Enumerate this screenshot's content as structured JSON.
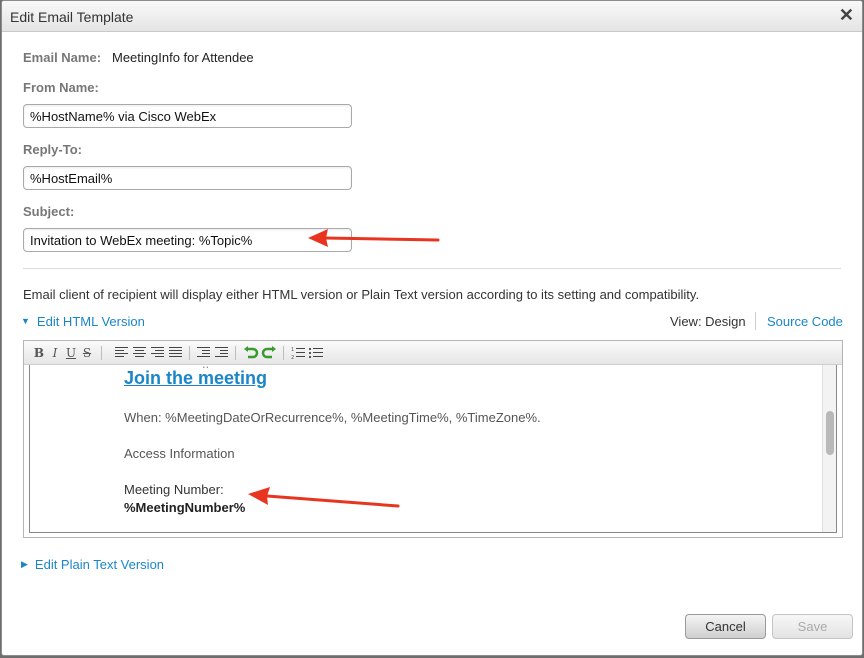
{
  "dialog": {
    "title": "Edit Email Template",
    "close_icon": "close-icon"
  },
  "fields": {
    "email_name_label": "Email Name:",
    "email_name_value": "MeetingInfo for Attendee",
    "from_name_label": "From Name:",
    "from_name_value": "%HostName% via Cisco WebEx",
    "reply_to_label": "Reply-To:",
    "reply_to_value": "%HostEmail%",
    "subject_label": "Subject:",
    "subject_value": "Invitation to WebEx meeting: %Topic%"
  },
  "info_text": "Email client of recipient will display either HTML version or Plain Text version according to its setting and compatibility.",
  "html_section": {
    "toggle_label": "Edit HTML Version",
    "view_label": "View: Design",
    "source_label": "Source Code"
  },
  "toolbar": {
    "bold": "B",
    "italic": "I",
    "underline": "U",
    "strike": "S"
  },
  "editor_content": {
    "join_link": "Join the meeting",
    "when_line": "When: %MeetingDateOrRecurrence%, %MeetingTime%, %TimeZone%.",
    "access_line": "Access Information",
    "meeting_number_label": "Meeting Number:",
    "meeting_number_value": "%MeetingNumber%"
  },
  "plain_section": {
    "toggle_label": "Edit Plain Text Version"
  },
  "buttons": {
    "cancel": "Cancel",
    "save": "Save"
  },
  "colors": {
    "link": "#1a86c7",
    "annotation_arrow": "#e8351f"
  }
}
